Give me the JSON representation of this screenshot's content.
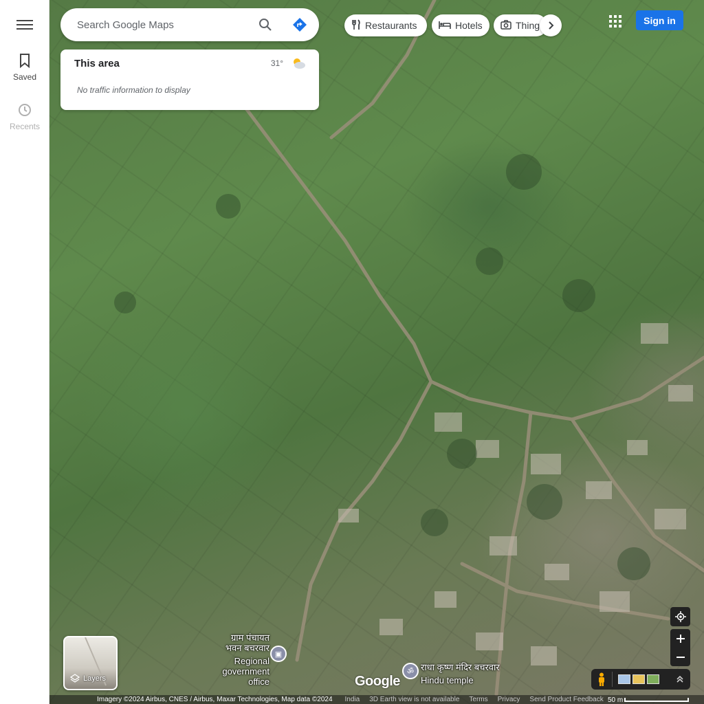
{
  "rail": {
    "saved_label": "Saved",
    "recents_label": "Recents"
  },
  "search": {
    "placeholder": "Search Google Maps"
  },
  "area_card": {
    "title": "This area",
    "temperature": "31°",
    "weather_icon": "partly-sunny-icon",
    "traffic_message": "No traffic information to display"
  },
  "chips": [
    {
      "label": "Restaurants",
      "icon": "fork-knife-icon"
    },
    {
      "label": "Hotels",
      "icon": "bed-icon"
    },
    {
      "label": "Things",
      "icon": "camera-icon"
    }
  ],
  "header": {
    "signin_label": "Sign in"
  },
  "places": [
    {
      "name": "ग्राम पंचायत भवन बचरवार",
      "line1": "ग्राम पंचायत",
      "line2": "भवन बचरवार",
      "category": "Regional government office",
      "cat1": "Regional",
      "cat2": "government office"
    },
    {
      "name": "राधा कृष्ण मंदिर बचरवार",
      "category": "Hindu temple"
    }
  ],
  "branding": {
    "logo": "Google"
  },
  "layers": {
    "label": "Layers"
  },
  "footer": {
    "imagery": "Imagery ©2024 Airbus, CNES / Airbus, Maxar Technologies, Map data ©2024",
    "country": "India",
    "earth_notice": "3D Earth view is not available",
    "terms": "Terms",
    "privacy": "Privacy",
    "feedback": "Send Product Feedback",
    "scale_label": "50 m"
  },
  "colors": {
    "accent": "#1a73e8",
    "control_bg": "#222222"
  }
}
